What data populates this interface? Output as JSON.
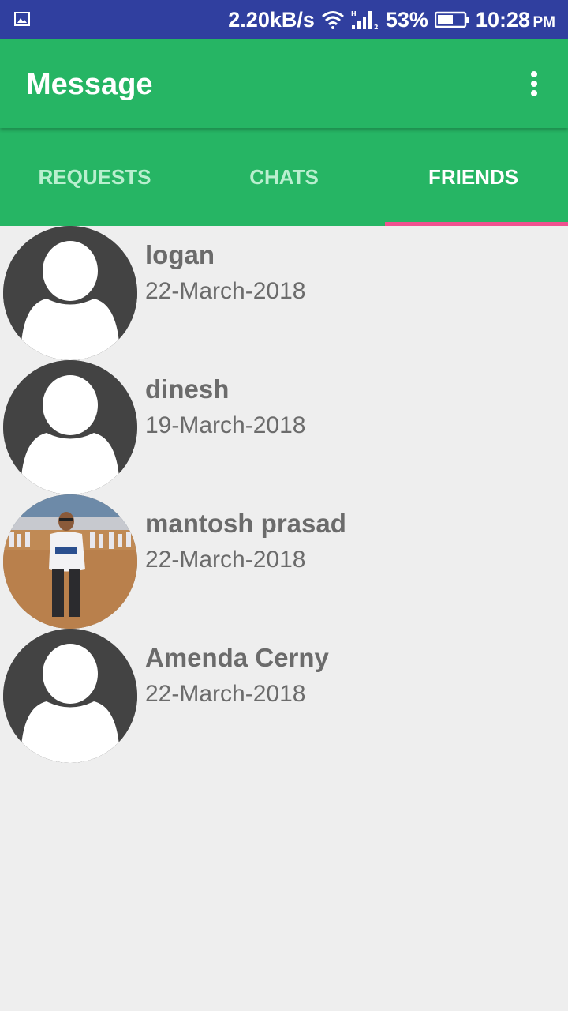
{
  "status_bar": {
    "net_speed": "2.20kB/s",
    "battery": "53%",
    "time": "10:28",
    "ampm": "PM",
    "icons": [
      "image-notification-icon",
      "wifi-icon",
      "signal-icon",
      "battery-icon"
    ]
  },
  "app_bar": {
    "title": "Message",
    "overflow_icon": "more-vertical-icon"
  },
  "tabs": [
    {
      "label": "REQUESTS",
      "active": false
    },
    {
      "label": "CHATS",
      "active": false
    },
    {
      "label": "FRIENDS",
      "active": true
    }
  ],
  "friends": [
    {
      "name": "logan",
      "date": "22-March-2018",
      "avatar": "default-avatar"
    },
    {
      "name": "dinesh",
      "date": "19-March-2018",
      "avatar": "default-avatar"
    },
    {
      "name": "mantosh prasad",
      "date": "22-March-2018",
      "avatar": "photo-avatar"
    },
    {
      "name": "Amenda Cerny",
      "date": "22-March-2018",
      "avatar": "default-avatar"
    }
  ],
  "colors": {
    "status_bar": "#303f9f",
    "primary": "#26b564",
    "tab_indicator": "#f0508f",
    "background": "#eeeeee",
    "text": "#6b6b6b"
  }
}
